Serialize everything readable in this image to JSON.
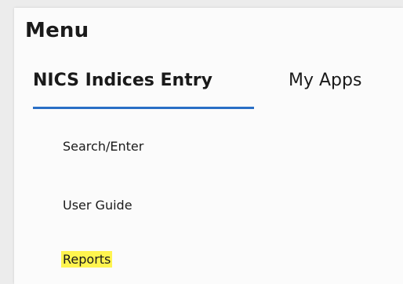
{
  "menu": {
    "title": "Menu",
    "tabs": [
      {
        "label": "NICS Indices Entry",
        "active": true
      },
      {
        "label": "My Apps",
        "active": false
      }
    ],
    "items": [
      {
        "label": "Search/Enter"
      },
      {
        "label": "User Guide"
      },
      {
        "label": "Reports",
        "highlighted": true
      }
    ]
  },
  "colors": {
    "tab_underline": "#2a6fc6",
    "highlight": "#fff44f"
  }
}
